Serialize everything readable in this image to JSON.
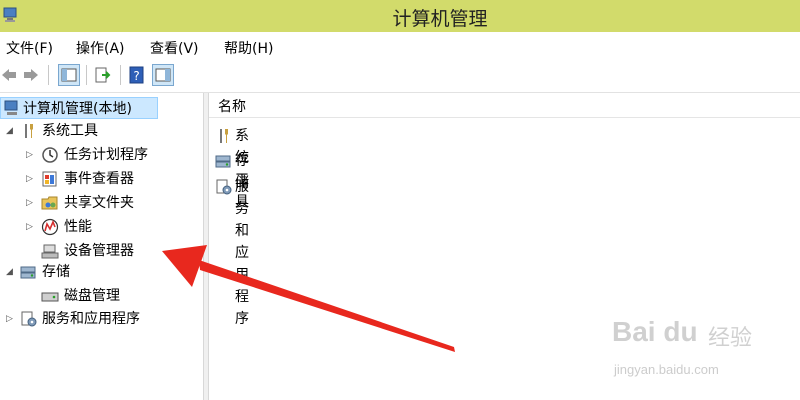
{
  "window": {
    "title": "计算机管理"
  },
  "menu": {
    "items": [
      "文件(F)",
      "操作(A)",
      "查看(V)",
      "帮助(H)"
    ]
  },
  "toolbar": {
    "buttons": [
      "back-icon",
      "forward-icon",
      "show-hide-tree-icon",
      "export-list-icon",
      "help-icon",
      "show-hide-action-pane-icon"
    ]
  },
  "tree": {
    "root": "计算机管理(本地)",
    "system_tools": "系统工具",
    "task_scheduler": "任务计划程序",
    "event_viewer": "事件查看器",
    "shared_folders": "共享文件夹",
    "performance": "性能",
    "device_manager": "设备管理器",
    "storage": "存储",
    "disk_management": "磁盘管理",
    "services_apps": "服务和应用程序"
  },
  "list": {
    "column_name": "名称",
    "rows": [
      "系统工具",
      "存储",
      "服务和应用程序"
    ]
  },
  "annotation": {
    "arrow_color": "#e8281e"
  },
  "watermark": {
    "logo": "Bai du",
    "brand": "经验",
    "url": "jingyan.baidu.com"
  },
  "colors": {
    "titlebar": "#d2db6b",
    "selection": "#cce8ff"
  }
}
